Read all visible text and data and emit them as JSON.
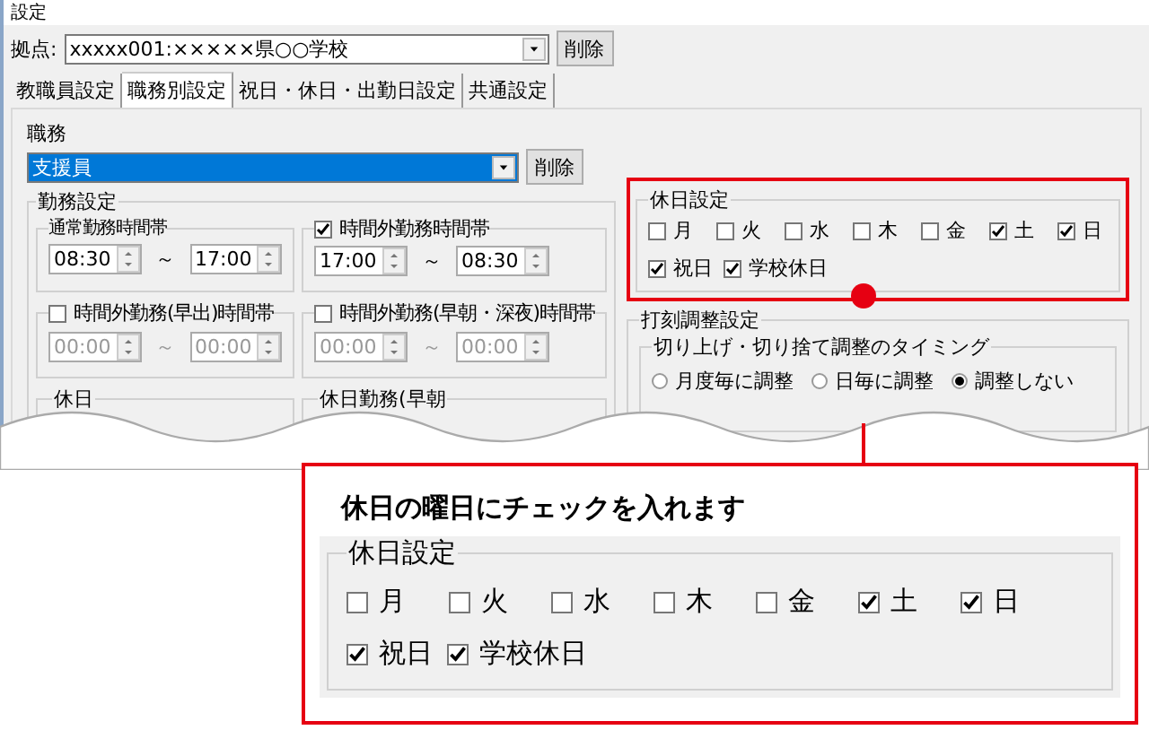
{
  "window": {
    "title": "設定"
  },
  "base": {
    "label": "拠点:",
    "value": "xxxxx001:×××××県○○学校",
    "delete_button": "削除"
  },
  "tabs": [
    {
      "label": "教職員設定",
      "selected": false
    },
    {
      "label": "職務別設定",
      "selected": true
    },
    {
      "label": "祝日・休日・出勤日設定",
      "selected": false
    },
    {
      "label": "共通設定",
      "selected": false
    }
  ],
  "job": {
    "label": "職務",
    "value": "支援員",
    "delete_button": "削除"
  },
  "work_settings": {
    "title": "勤務設定",
    "groups": [
      {
        "kind": "plain",
        "title": "通常勤務時間帯",
        "disabled": false,
        "from": "08:30",
        "to": "17:00",
        "separator": "～"
      },
      {
        "kind": "checkbox",
        "title": "時間外勤務時間帯",
        "checked": true,
        "disabled": false,
        "from": "17:00",
        "to": "08:30",
        "separator": "～"
      },
      {
        "kind": "checkbox",
        "title": "時間外勤務(早出)時間帯",
        "checked": false,
        "disabled": true,
        "from": "00:00",
        "to": "00:00",
        "separator": "～"
      },
      {
        "kind": "checkbox",
        "title": "時間外勤務(早朝・深夜)時間帯",
        "checked": false,
        "disabled": true,
        "from": "00:00",
        "to": "00:00",
        "separator": "～"
      }
    ],
    "cut_groups": [
      "休日",
      "休日勤務(早朝"
    ]
  },
  "holiday_settings": {
    "title": "休日設定",
    "days": [
      {
        "label": "月",
        "checked": false
      },
      {
        "label": "火",
        "checked": false
      },
      {
        "label": "水",
        "checked": false
      },
      {
        "label": "木",
        "checked": false
      },
      {
        "label": "金",
        "checked": false
      },
      {
        "label": "土",
        "checked": true
      },
      {
        "label": "日",
        "checked": true
      }
    ],
    "extra": [
      {
        "label": "祝日",
        "checked": true
      },
      {
        "label": "学校休日",
        "checked": true
      }
    ]
  },
  "stamp_adjust": {
    "title": "打刻調整設定",
    "timing": {
      "title": "切り上げ・切り捨て調整のタイミング",
      "options": [
        {
          "label": "月度毎に調整",
          "selected": false
        },
        {
          "label": "日毎に調整",
          "selected": false
        },
        {
          "label": "調整しない",
          "selected": true
        }
      ]
    }
  },
  "callout": {
    "text": "休日の曜日にチェックを入れます",
    "holiday_settings": {
      "title": "休日設定",
      "days": [
        {
          "label": "月",
          "checked": false
        },
        {
          "label": "火",
          "checked": false
        },
        {
          "label": "水",
          "checked": false
        },
        {
          "label": "木",
          "checked": false
        },
        {
          "label": "金",
          "checked": false
        },
        {
          "label": "土",
          "checked": true
        },
        {
          "label": "日",
          "checked": true
        }
      ],
      "extra": [
        {
          "label": "祝日",
          "checked": true
        },
        {
          "label": "学校休日",
          "checked": true
        }
      ]
    }
  }
}
